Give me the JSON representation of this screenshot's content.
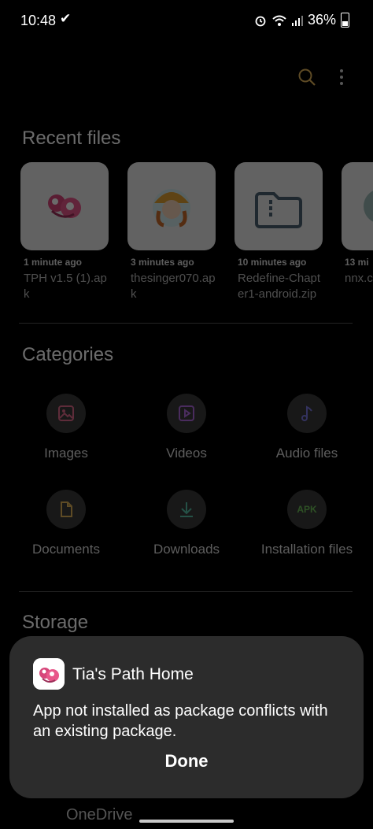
{
  "status_bar": {
    "time": "10:48",
    "battery": "36%",
    "battery_level": 0.36
  },
  "toolbar": {
    "search_icon": "search-icon",
    "more_icon": "more-vert-icon"
  },
  "recent": {
    "title": "Recent files",
    "items": [
      {
        "ago": "1 minute ago",
        "name": "TPH v1.5 (1).apk"
      },
      {
        "ago": "3 minutes ago",
        "name": "thesinger070.apk"
      },
      {
        "ago": "10 minutes ago",
        "name": "Redefine-Chapter1-android.zip"
      },
      {
        "ago": "13 mi",
        "name": "nnx.ce.apk"
      }
    ]
  },
  "categories": {
    "title": "Categories",
    "items": [
      {
        "label": "Images",
        "icon": "image-icon",
        "color": "#e06a8a"
      },
      {
        "label": "Videos",
        "icon": "video-icon",
        "color": "#b06ae0"
      },
      {
        "label": "Audio files",
        "icon": "music-note-icon",
        "color": "#7a78e0"
      },
      {
        "label": "Documents",
        "icon": "document-icon",
        "color": "#e0b25a"
      },
      {
        "label": "Downloads",
        "icon": "download-icon",
        "color": "#58c0a8"
      },
      {
        "label": "Installation files",
        "icon": "apk-icon",
        "badge": "APK",
        "color": "#6ec05a"
      }
    ]
  },
  "storage": {
    "title": "Storage",
    "peek_label": "OneDrive"
  },
  "dialog": {
    "app_name": "Tia's Path Home",
    "message": "App not installed as package conflicts with an existing package.",
    "done_label": "Done"
  }
}
